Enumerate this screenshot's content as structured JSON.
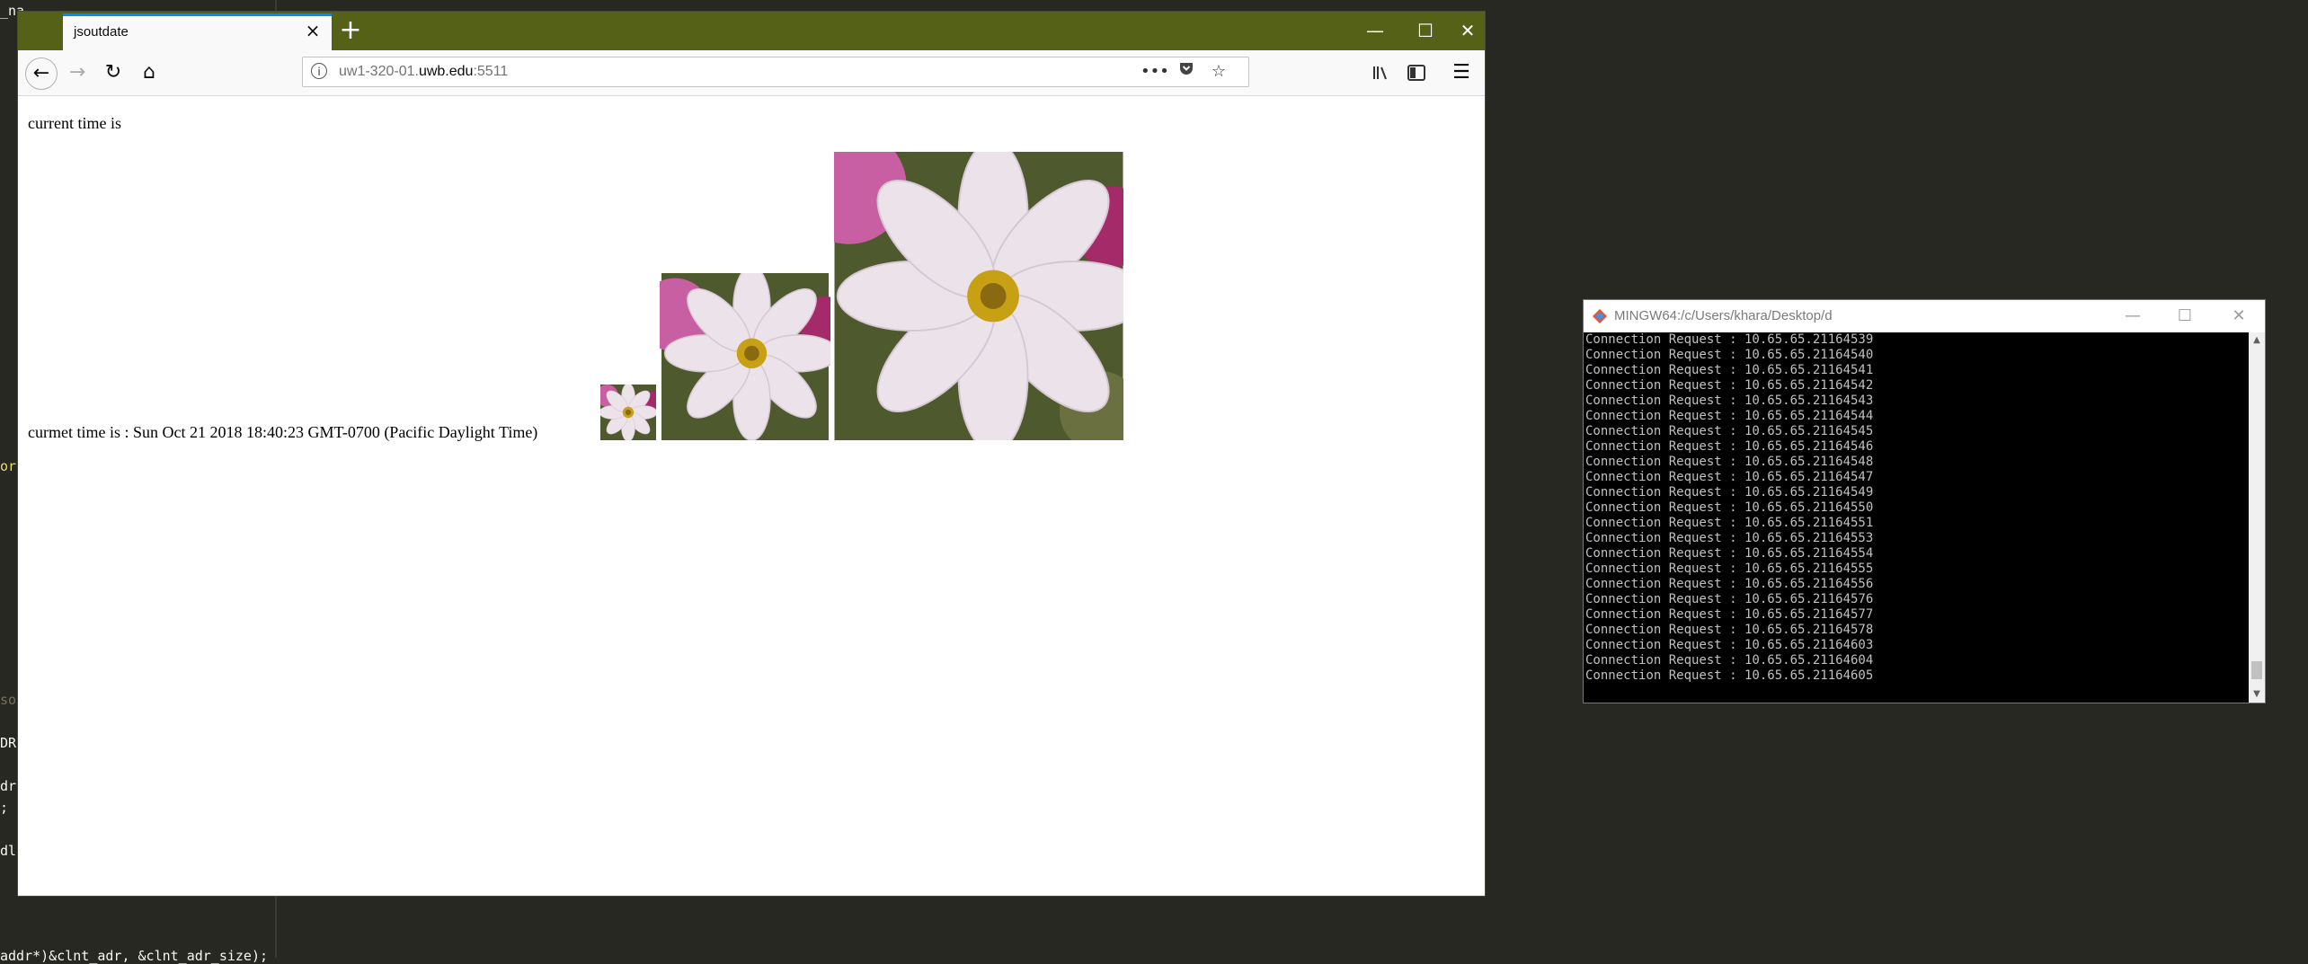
{
  "editor": {
    "fragments": [
      "_na",
      "or",
      "so",
      "DR",
      "dr",
      ";",
      "dl",
      "addr*)&clnt_adr, &clnt_adr_size);"
    ]
  },
  "browser": {
    "tab_title": "jsoutdate",
    "url_host_prefix": "uw1-320-01.",
    "url_host_main": "uwb.edu",
    "url_port": ":5511",
    "content": {
      "line1": "current time is",
      "line2": "curmet time is : Sun Oct 21 2018 18:40:23 GMT-0700 (Pacific Daylight Time)"
    }
  },
  "terminal": {
    "title": "MINGW64:/c/Users/khara/Desktop/d",
    "lines": [
      "Connection Request : 10.65.65.21164539",
      "Connection Request : 10.65.65.21164540",
      "Connection Request : 10.65.65.21164541",
      "Connection Request : 10.65.65.21164542",
      "Connection Request : 10.65.65.21164543",
      "Connection Request : 10.65.65.21164544",
      "Connection Request : 10.65.65.21164545",
      "Connection Request : 10.65.65.21164546",
      "Connection Request : 10.65.65.21164548",
      "Connection Request : 10.65.65.21164547",
      "Connection Request : 10.65.65.21164549",
      "Connection Request : 10.65.65.21164550",
      "Connection Request : 10.65.65.21164551",
      "Connection Request : 10.65.65.21164553",
      "Connection Request : 10.65.65.21164554",
      "Connection Request : 10.65.65.21164555",
      "Connection Request : 10.65.65.21164556",
      "Connection Request : 10.65.65.21164576",
      "Connection Request : 10.65.65.21164577",
      "Connection Request : 10.65.65.21164578",
      "Connection Request : 10.65.65.21164603",
      "Connection Request : 10.65.65.21164604",
      "Connection Request : 10.65.65.21164605"
    ]
  },
  "colors": {
    "firefox_titlebar": "#556116",
    "tab_accent": "#0a84ff",
    "editor_bg": "#272822",
    "terminal_bg": "#000000"
  },
  "icons": [
    "back-arrow-icon",
    "forward-arrow-icon",
    "reload-icon",
    "home-icon",
    "info-icon",
    "more-icon",
    "pocket-icon",
    "star-icon",
    "library-icon",
    "sidebar-icon",
    "menu-icon",
    "flower-image"
  ]
}
